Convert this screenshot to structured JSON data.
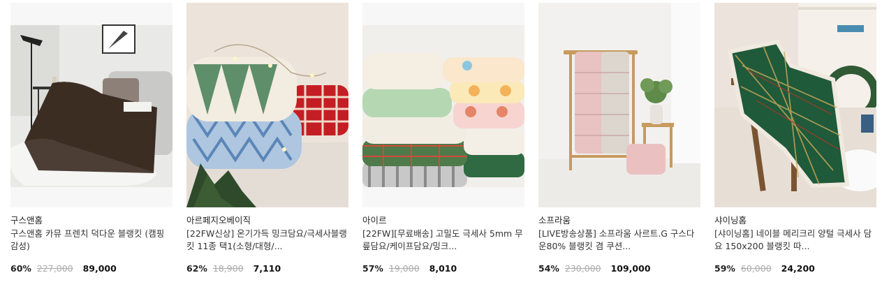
{
  "products": [
    {
      "brand": "구스앤홈",
      "title": "구스앤홈 카뮤 프렌치 덕다운 블랭킷 (캠핑 감성)",
      "discount": "60%",
      "original_price": "227,000",
      "sale_price": "89,000"
    },
    {
      "brand": "아르페지오베이직",
      "title": "[22FW신상] 온기가득 밍크담요/극세사블랭킷 11종 택1(소형/대형/...",
      "discount": "62%",
      "original_price": "18,900",
      "sale_price": "7,110"
    },
    {
      "brand": "아이르",
      "title": "[22FW][무료배송] 고밀도 극세사 5mm 무릎담요/케이프담요/밍크...",
      "discount": "57%",
      "original_price": "19,000",
      "sale_price": "8,010"
    },
    {
      "brand": "소프라움",
      "title": "[LIVE방송상품] 소프라움 사르트.G 구스다운80% 블랭킷 겸 쿠션...",
      "discount": "54%",
      "original_price": "230,000",
      "sale_price": "109,000"
    },
    {
      "brand": "샤이닝홈",
      "title": "[샤이닝홈] 네이블 메리크리 양털 극세사 담요 150x200 블랭킷 따...",
      "discount": "59%",
      "original_price": "60,000",
      "sale_price": "24,200"
    }
  ]
}
